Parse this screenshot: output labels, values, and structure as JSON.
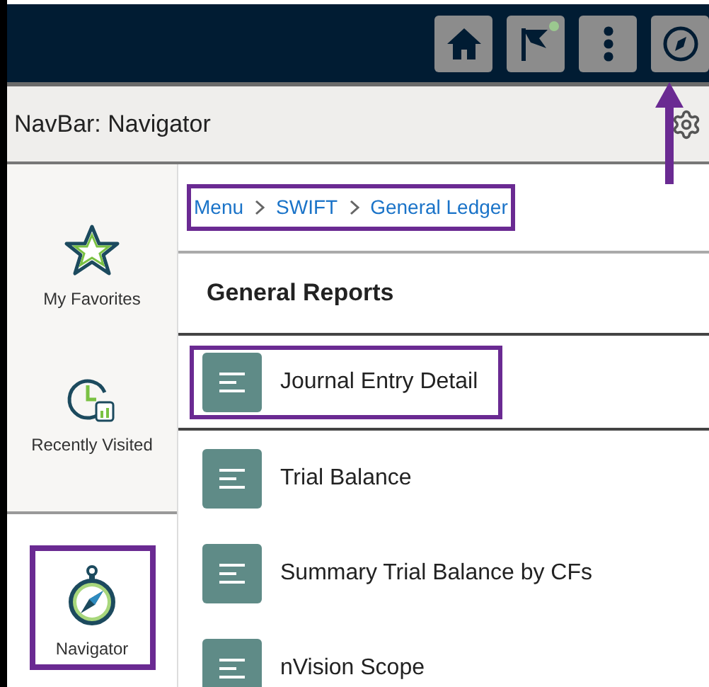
{
  "toolbar": {
    "buttons": [
      {
        "kind": "home",
        "notification": false
      },
      {
        "kind": "flag",
        "notification": true
      },
      {
        "kind": "more",
        "notification": false
      },
      {
        "kind": "navigator",
        "notification": false
      }
    ]
  },
  "title": "NavBar: Navigator",
  "sidebar": {
    "items": [
      {
        "kind": "favorites",
        "label": "My Favorites",
        "selected": false,
        "highlighted": false
      },
      {
        "kind": "recent",
        "label": "Recently Visited",
        "selected": false,
        "highlighted": false
      },
      {
        "kind": "navigator",
        "label": "Navigator",
        "selected": true,
        "highlighted": true
      }
    ]
  },
  "breadcrumb": {
    "items": [
      "Menu",
      "SWIFT",
      "General Ledger"
    ],
    "highlighted": true
  },
  "section_title": "General Reports",
  "reports": [
    {
      "label": "Journal Entry Detail",
      "highlighted": true
    },
    {
      "label": "Trial Balance",
      "highlighted": false
    },
    {
      "label": "Summary Trial Balance by CFs",
      "highlighted": false
    },
    {
      "label": "nVision Scope",
      "highlighted": false
    }
  ]
}
